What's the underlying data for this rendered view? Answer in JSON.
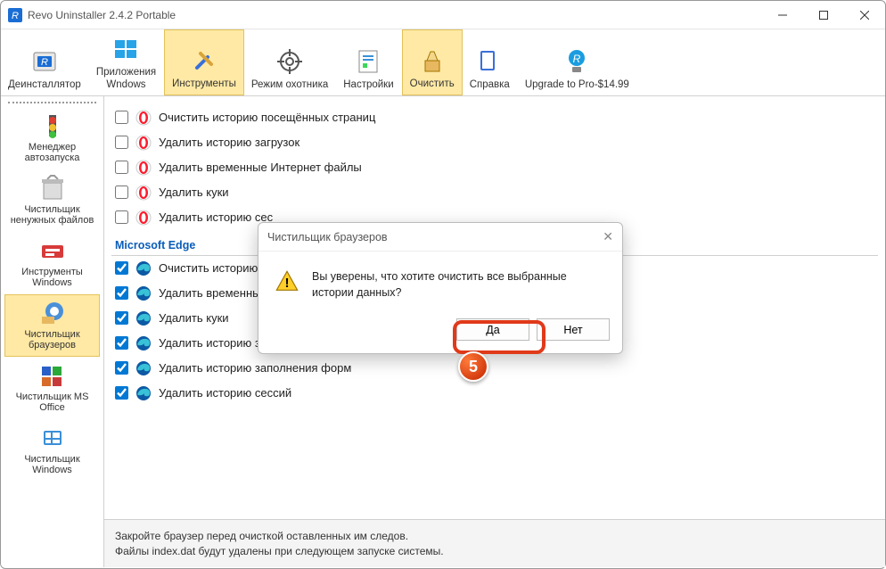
{
  "window": {
    "title": "Revo Uninstaller 2.4.2 Portable"
  },
  "toolbar": [
    {
      "id": "uninstaller",
      "label": "Деинсталлятор"
    },
    {
      "id": "winapps",
      "label": "Приложения\nWndows"
    },
    {
      "id": "tools",
      "label": "Инструменты",
      "active": true
    },
    {
      "id": "hunter",
      "label": "Режим охотника"
    },
    {
      "id": "settings",
      "label": "Настройки"
    },
    {
      "id": "clean",
      "label": "Очистить",
      "active": true
    },
    {
      "id": "help",
      "label": "Справка"
    },
    {
      "id": "upgrade",
      "label": "Upgrade to Pro-$14.99"
    }
  ],
  "sidebar": [
    {
      "id": "autorun",
      "label": "Менеджер автозапуска"
    },
    {
      "id": "junk",
      "label": "Чистильщик ненужных файлов"
    },
    {
      "id": "wintools",
      "label": "Инструменты Windows"
    },
    {
      "id": "browsers",
      "label": "Чистильщик браузеров",
      "active": true
    },
    {
      "id": "office",
      "label": "Чистильщик MS Office"
    },
    {
      "id": "wincleaner",
      "label": "Чистильщик Windows"
    }
  ],
  "groups": [
    {
      "name": "opera",
      "items": [
        {
          "checked": false,
          "label": "Очистить историю посещённых страниц"
        },
        {
          "checked": false,
          "label": "Удалить историю загрузок"
        },
        {
          "checked": false,
          "label": "Удалить временные Интернет файлы"
        },
        {
          "checked": false,
          "label": "Удалить куки"
        },
        {
          "checked": false,
          "label": "Удалить историю сес"
        }
      ]
    },
    {
      "name": "Microsoft Edge",
      "header": "Microsoft Edge",
      "items": [
        {
          "checked": true,
          "label": "Очистить историю по"
        },
        {
          "checked": true,
          "label": "Удалить временные И"
        },
        {
          "checked": true,
          "label": "Удалить куки"
        },
        {
          "checked": true,
          "label": "Удалить историю загрузок"
        },
        {
          "checked": true,
          "label": "Удалить историю заполнения форм"
        },
        {
          "checked": true,
          "label": "Удалить историю сессий"
        }
      ]
    }
  ],
  "footer": {
    "line1": "Закройте браузер перед очисткой оставленных им следов.",
    "line2": "Файлы index.dat будут удалены при следующем запуске системы."
  },
  "dialog": {
    "title": "Чистильщик браузеров",
    "message": "Вы уверены, что хотите очистить все выбранные истории данных?",
    "yes": "Да",
    "no": "Нет"
  },
  "step": "5"
}
